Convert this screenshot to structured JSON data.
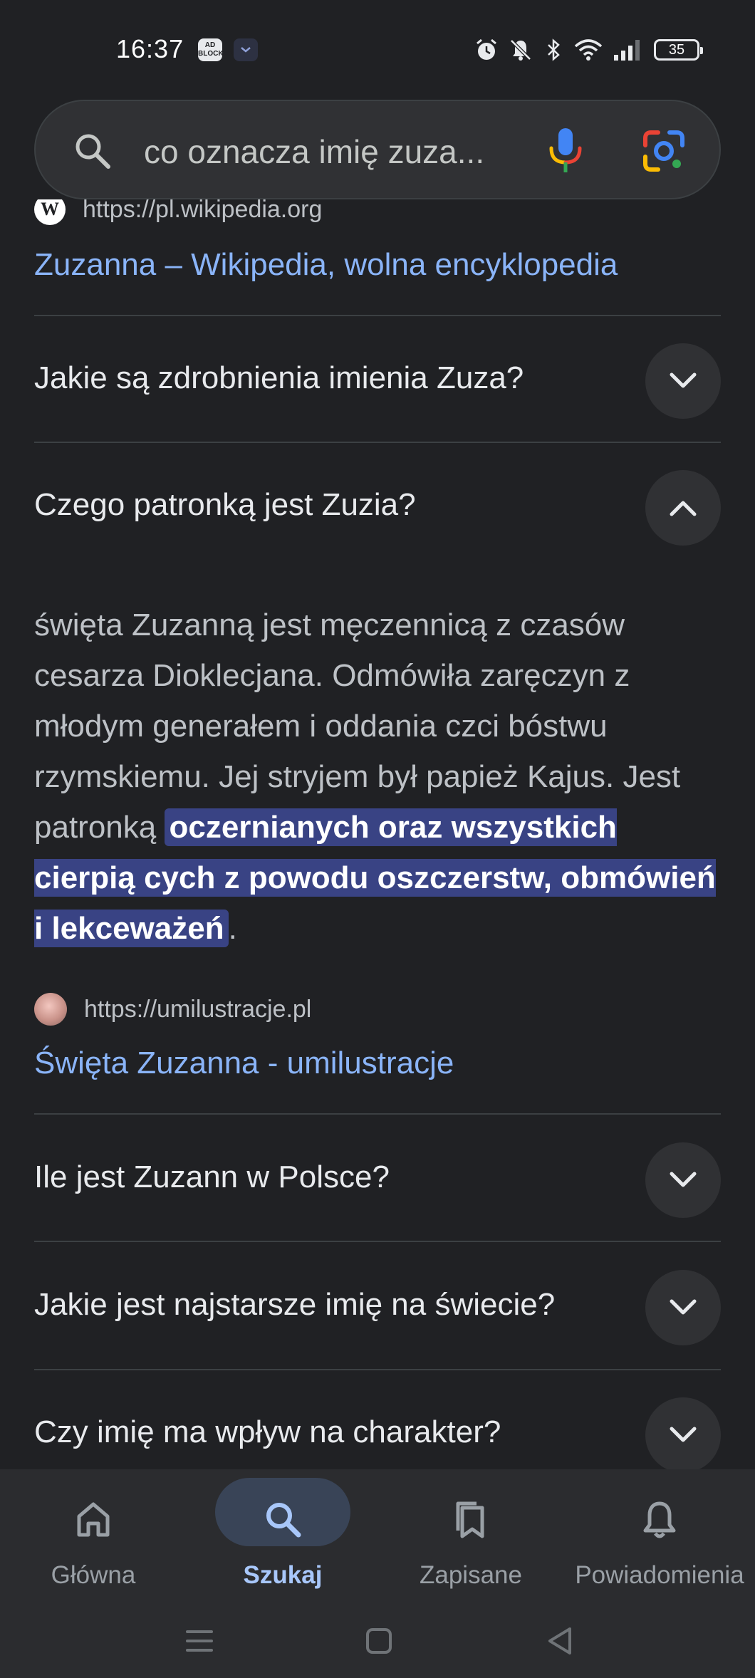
{
  "status_bar": {
    "time": "16:37",
    "app_icon_1_label": "AD BLOCKER",
    "battery": "35"
  },
  "search": {
    "query": "co oznacza imię zuza..."
  },
  "results": {
    "partial_url": "https://pl.wikipedia.org",
    "wiki_title": "Zuzanna – Wikipedia, wolna encyklopedia"
  },
  "faq": {
    "q1": "Jakie są zdrobnienia imienia Zuza?",
    "q2": "Czego patronką jest Zuzia?",
    "answer_plain": "święta Zuzanną jest męczennicą z czasów cesarza Dioklecjana. Odmówiła zaręczyn z młodym generałem i oddania czci bóstwu rzymskiemu. Jej stryjem był papież Kajus. Jest patronką ",
    "answer_highlight": "oczernianych oraz wszystkich cierpią cych z powodu oszczerstw, obmówień i lekceważeń",
    "answer_end": ".",
    "source_url": "https://umilustracje.pl",
    "source_title": "Święta Zuzanna - umilustracje",
    "q3": "Ile jest Zuzann w Polsce?",
    "q4": "Jakie jest najstarsze imię na świecie?",
    "q5": "Czy imię ma wpływ na charakter?"
  },
  "bottom_nav": {
    "home": "Główna",
    "search": "Szukaj",
    "saved": "Zapisane",
    "notifications": "Powiadomienia"
  },
  "colors": {
    "background": "#202124",
    "link": "#8ab4f8",
    "highlight": "#394384",
    "active_nav": "#a8c7fa"
  }
}
